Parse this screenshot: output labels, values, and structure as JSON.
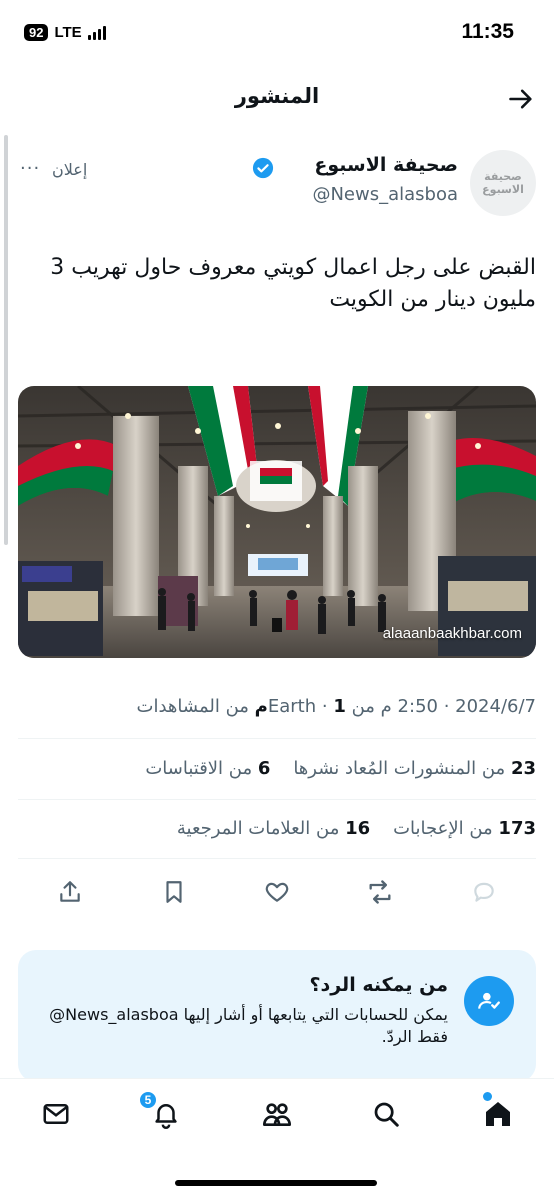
{
  "status_bar": {
    "time": "11:35",
    "battery": "92",
    "network": "LTE"
  },
  "header": {
    "title": "المنشور"
  },
  "author": {
    "name": "صحيفة الاسبوع",
    "handle": "@News_alasboa",
    "avatar_text": "صحيفة الاسبوع",
    "ad_label": "إعلان",
    "more_label": "···"
  },
  "tweet": {
    "text": "القبض على رجل اعمال كويتي معروف حاول تهريب 3 مليون دينار من الكويت",
    "image_caption": "alaaanbaakhbar.com"
  },
  "meta": {
    "date": "2024/6/7",
    "time": "2:50 م",
    "source": "من Earth",
    "views_count": "1م",
    "views_label": "من المشاهدات"
  },
  "stats": {
    "reposts_count": "23",
    "reposts_label": "من المنشورات المُعاد نشرها",
    "quotes_count": "6",
    "quotes_label": "من الاقتباسات",
    "likes_count": "173",
    "likes_label": "من الإعجابات",
    "bookmarks_count": "16",
    "bookmarks_label": "من العلامات المرجعية"
  },
  "reply_card": {
    "title": "من يمكنه الرد؟",
    "body": "يمكن للحسابات التي يتابعها أو أشار إليها ‎@News_alasboa‎ فقط الردّ."
  },
  "nav": {
    "notifications_badge": "5"
  },
  "colors": {
    "accent": "#1d9bf0",
    "text": "#0f1419",
    "muted": "#536471",
    "card_bg": "#e8f5fd"
  }
}
